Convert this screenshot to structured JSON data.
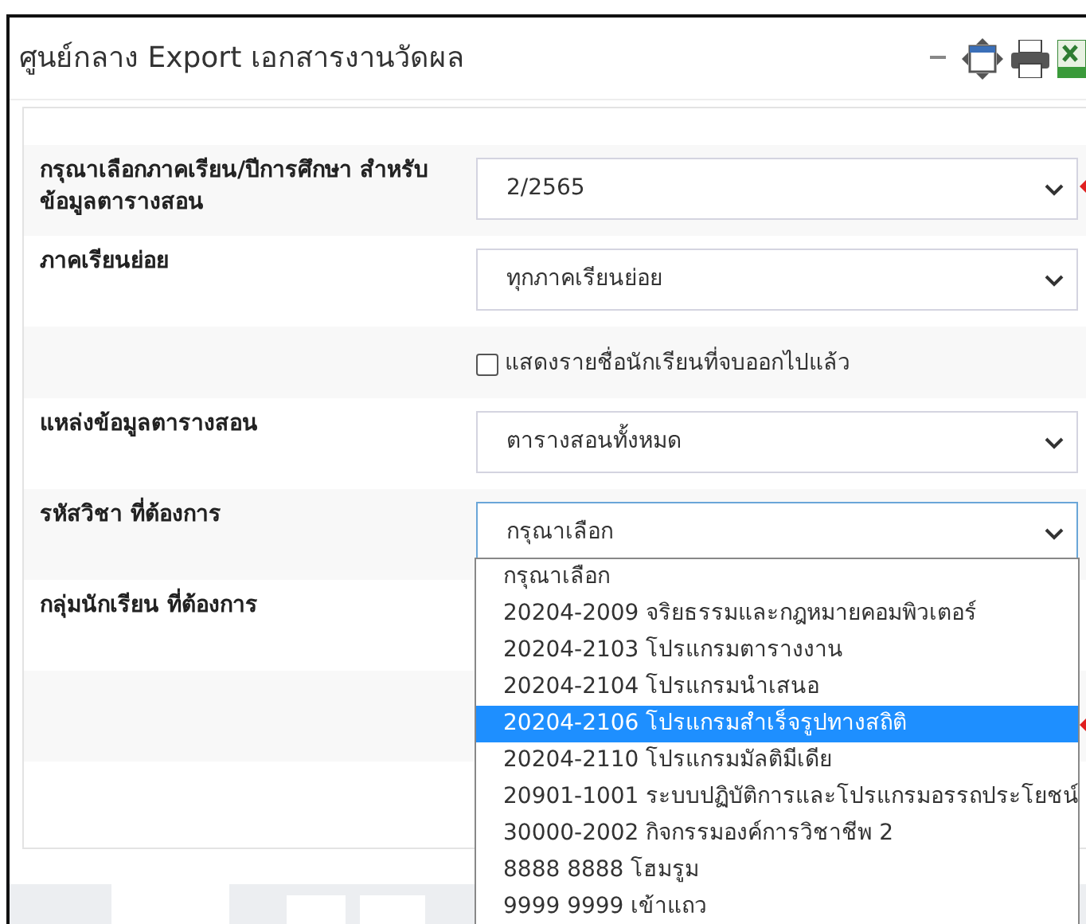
{
  "window": {
    "title": "ศูนย์กลาง Export เอกสารงานวัดผล"
  },
  "form_rows": [
    {
      "kind": "select",
      "label": "กรุณาเลือกภาคเรียน/ปีการศึกษา สำหรับข้อมูลตารางสอน",
      "value": "2/2565",
      "focused": false,
      "marked": true
    },
    {
      "kind": "select",
      "label": "ภาคเรียนย่อย",
      "value": "ทุกภาคเรียนย่อย",
      "focused": false,
      "marked": false
    },
    {
      "kind": "checkbox",
      "label": "แสดงรายชื่อนักเรียนที่จบออกไปแล้ว",
      "checked": false
    },
    {
      "kind": "select",
      "label": "แหล่งข้อมูลตารางสอน",
      "value": "ตารางสอนทั้งหมด",
      "focused": false,
      "marked": false
    },
    {
      "kind": "select",
      "label": "รหัสวิชา ที่ต้องการ",
      "value": "กรุณาเลือก",
      "focused": true,
      "marked": false
    },
    {
      "kind": "label",
      "label": "กลุ่มนักเรียน ที่ต้องการ"
    },
    {
      "kind": "empty"
    }
  ],
  "dropdown_options": [
    {
      "label": "กรุณาเลือก",
      "selected": false
    },
    {
      "label": "20204-2009 จริยธรรมและกฎหมายคอมพิวเตอร์",
      "selected": false
    },
    {
      "label": "20204-2103 โปรแกรมตารางงาน",
      "selected": false
    },
    {
      "label": "20204-2104 โปรแกรมนำเสนอ",
      "selected": false
    },
    {
      "label": "20204-2106 โปรแกรมสำเร็จรูปทางสถิติ",
      "selected": true
    },
    {
      "label": "20204-2110 โปรแกรมมัลติมีเดีย",
      "selected": false
    },
    {
      "label": "20901-1001 ระบบปฏิบัติการและโปรแกรมอรรถประโยชน์",
      "selected": false
    },
    {
      "label": "30000-2002 กิจกรรมองค์การวิชาชีพ 2",
      "selected": false
    },
    {
      "label": "8888 8888 โฮมรูม",
      "selected": false
    },
    {
      "label": "9999 9999 เข้าแถว",
      "selected": false
    }
  ]
}
